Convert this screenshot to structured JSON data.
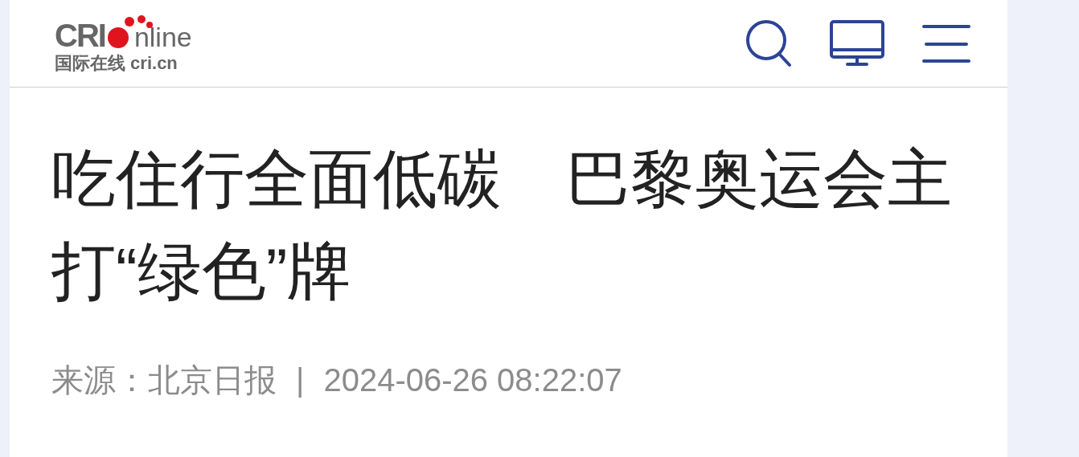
{
  "header": {
    "logo": {
      "mark": "CRI",
      "word": "nline",
      "tagline": "国际在线 cri.cn"
    }
  },
  "article": {
    "title": "吃住行全面低碳　巴黎奥运会主打“绿色”牌",
    "source": "来源：北京日报",
    "separator": "|",
    "time": "2024-06-26 08:22:07"
  }
}
